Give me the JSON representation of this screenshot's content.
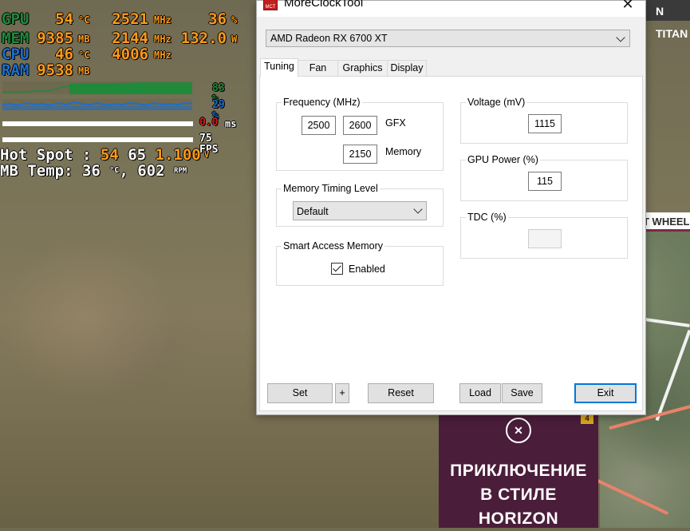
{
  "osd": {
    "rows": [
      {
        "label": "GPU",
        "v1": "54",
        "u1": "°C",
        "v2": "2521",
        "u2": "MHz",
        "v3": "36",
        "u3": "%"
      },
      {
        "label": "MEM",
        "v1": "9385",
        "u1": "MB",
        "v2": "2144",
        "u2": "MHz",
        "v3": "132.0",
        "u3": "W"
      },
      {
        "label": "CPU",
        "v1": "46",
        "u1": "°C",
        "v2": "4006",
        "u2": "MHz"
      },
      {
        "label": "RAM",
        "v1": "9538",
        "u1": "MB"
      }
    ],
    "gpu_graph_pct": "83 %",
    "cpu_graph_pct": "29 %",
    "frametime_value": "0.0",
    "frametime_unit": "ms",
    "fps": "75 FPS",
    "hotspot_text": "Hot Spot : ",
    "hotspot_v1": "54",
    "hotspot_v2": "65",
    "hotspot_v3": "1.100",
    "hotspot_unit": "V",
    "mb_text": "MB Temp: 36 ",
    "mb_unit1": "°C",
    "mb_text2": ", 602 ",
    "mb_unit2": "RPM",
    "colors": {
      "gpu": "#1e8a3a",
      "cpu": "#1a6fd0",
      "value": "#ff9a1a",
      "frametime": "#d02020"
    }
  },
  "background": {
    "top_banner": "N TITAN",
    "side_banner": "T WHEEL",
    "promo_badge": "4",
    "promo_icon": "ticket-icon",
    "promo_line1": "ПРИКЛЮЧЕНИЕ",
    "promo_line2": "В СТИЛЕ",
    "promo_line3": "HORIZON"
  },
  "window": {
    "title": "MoreClockTool",
    "device": "AMD Radeon RX 6700 XT",
    "tabs": [
      "Tuning",
      "Fan",
      "Graphics",
      "Display"
    ],
    "active_tab": "Tuning",
    "frequency": {
      "label": "Frequency (MHz)",
      "gfx_min": "2500",
      "gfx_max": "2600",
      "gfx_label": "GFX",
      "memory": "2150",
      "memory_label": "Memory"
    },
    "memory_timing": {
      "label": "Memory Timing Level",
      "value": "Default"
    },
    "sam": {
      "label": "Smart Access Memory",
      "checkbox_label": "Enabled",
      "checked": true
    },
    "voltage": {
      "label": "Voltage (mV)",
      "value": "1115"
    },
    "gpu_power": {
      "label": "GPU Power (%)",
      "value": "115"
    },
    "tdc": {
      "label": "TDC (%)",
      "value": ""
    },
    "buttons": {
      "set": "Set",
      "plus": "+",
      "reset": "Reset",
      "load": "Load",
      "save": "Save",
      "exit": "Exit"
    }
  }
}
